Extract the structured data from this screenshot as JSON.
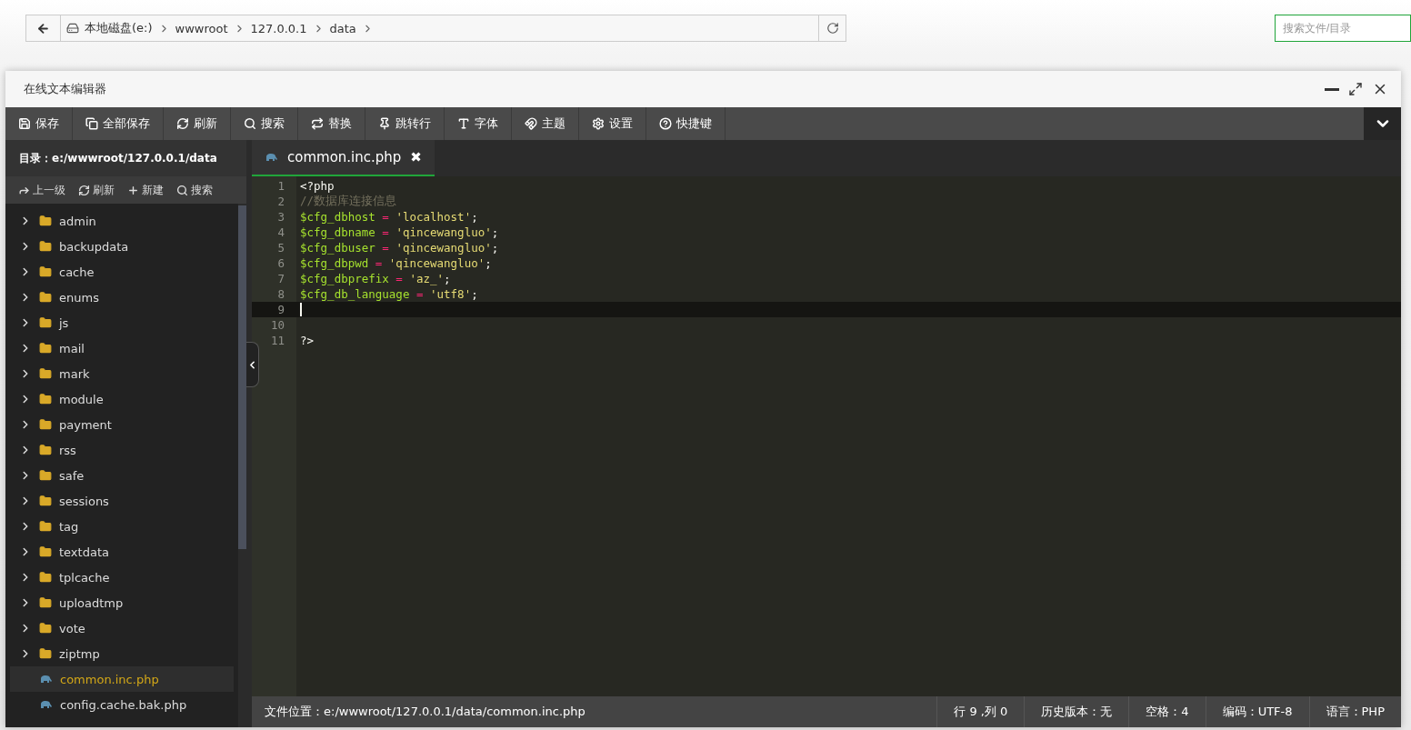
{
  "address_bar": {
    "crumbs": [
      "本地磁盘(e:)",
      "wwwroot",
      "127.0.0.1",
      "data"
    ]
  },
  "search": {
    "placeholder": "搜索文件/目录"
  },
  "window": {
    "title": "在线文本编辑器"
  },
  "toolbar": [
    "保存",
    "全部保存",
    "刷新",
    "搜索",
    "替换",
    "跳转行",
    "字体",
    "主题",
    "设置",
    "快捷键"
  ],
  "sidebar": {
    "directory": "目录：e:/wwwroot/127.0.0.1/data",
    "actions": [
      "上一级",
      "刷新",
      "新建",
      "搜索"
    ],
    "items": [
      {
        "kind": "folder",
        "name": "admin",
        "selected": false
      },
      {
        "kind": "folder",
        "name": "backupdata",
        "selected": false
      },
      {
        "kind": "folder",
        "name": "cache",
        "selected": false
      },
      {
        "kind": "folder",
        "name": "enums",
        "selected": false
      },
      {
        "kind": "folder",
        "name": "js",
        "selected": false
      },
      {
        "kind": "folder",
        "name": "mail",
        "selected": false
      },
      {
        "kind": "folder",
        "name": "mark",
        "selected": false
      },
      {
        "kind": "folder",
        "name": "module",
        "selected": false
      },
      {
        "kind": "folder",
        "name": "payment",
        "selected": false
      },
      {
        "kind": "folder",
        "name": "rss",
        "selected": false
      },
      {
        "kind": "folder",
        "name": "safe",
        "selected": false
      },
      {
        "kind": "folder",
        "name": "sessions",
        "selected": false
      },
      {
        "kind": "folder",
        "name": "tag",
        "selected": false
      },
      {
        "kind": "folder",
        "name": "textdata",
        "selected": false
      },
      {
        "kind": "folder",
        "name": "tplcache",
        "selected": false
      },
      {
        "kind": "folder",
        "name": "uploadtmp",
        "selected": false
      },
      {
        "kind": "folder",
        "name": "vote",
        "selected": false
      },
      {
        "kind": "folder",
        "name": "ziptmp",
        "selected": false
      },
      {
        "kind": "file",
        "name": "common.inc.php",
        "selected": true
      },
      {
        "kind": "file",
        "name": "config.cache.bak.php",
        "selected": false
      }
    ]
  },
  "tabs": [
    {
      "label": "common.inc.php",
      "close": "✖",
      "selected": true
    }
  ],
  "code": [
    {
      "number": "1",
      "active": false,
      "tokens": [
        {
          "kind": "plain",
          "text": "<?php"
        }
      ]
    },
    {
      "number": "2",
      "active": false,
      "tokens": [
        {
          "kind": "comment",
          "text": "//数据库连接信息"
        }
      ]
    },
    {
      "number": "3",
      "active": false,
      "tokens": [
        {
          "kind": "variable",
          "text": "$cfg_dbhost"
        },
        {
          "kind": "operator",
          "text": " = "
        },
        {
          "kind": "string",
          "text": "'localhost'"
        },
        {
          "kind": "plain",
          "text": ";"
        }
      ]
    },
    {
      "number": "4",
      "active": false,
      "tokens": [
        {
          "kind": "variable",
          "text": "$cfg_dbname"
        },
        {
          "kind": "operator",
          "text": " = "
        },
        {
          "kind": "string",
          "text": "'qincewangluo'"
        },
        {
          "kind": "plain",
          "text": ";"
        }
      ]
    },
    {
      "number": "5",
      "active": false,
      "tokens": [
        {
          "kind": "variable",
          "text": "$cfg_dbuser"
        },
        {
          "kind": "operator",
          "text": " = "
        },
        {
          "kind": "string",
          "text": "'qincewangluo'"
        },
        {
          "kind": "plain",
          "text": ";"
        }
      ]
    },
    {
      "number": "6",
      "active": false,
      "tokens": [
        {
          "kind": "variable",
          "text": "$cfg_dbpwd"
        },
        {
          "kind": "operator",
          "text": " = "
        },
        {
          "kind": "string",
          "text": "'qincewangluo'"
        },
        {
          "kind": "plain",
          "text": ";"
        }
      ]
    },
    {
      "number": "7",
      "active": false,
      "tokens": [
        {
          "kind": "variable",
          "text": "$cfg_dbprefix"
        },
        {
          "kind": "operator",
          "text": " = "
        },
        {
          "kind": "string",
          "text": "'az_'"
        },
        {
          "kind": "plain",
          "text": ";"
        }
      ]
    },
    {
      "number": "8",
      "active": false,
      "tokens": [
        {
          "kind": "variable",
          "text": "$cfg_db_language"
        },
        {
          "kind": "operator",
          "text": " = "
        },
        {
          "kind": "string",
          "text": "'utf8'"
        },
        {
          "kind": "plain",
          "text": ";"
        }
      ]
    },
    {
      "number": "9",
      "active": true
    },
    {
      "number": "10",
      "active": false
    },
    {
      "number": "11",
      "active": false,
      "tokens": [
        {
          "kind": "plain",
          "text": "?>"
        }
      ]
    }
  ],
  "status_bar": {
    "path": "文件位置：e:/wwwroot/127.0.0.1/data/common.inc.php",
    "items": [
      "行 9 ,列 0",
      "历史版本：无",
      "空格：4",
      "编码：UTF-8",
      "语言：PHP"
    ]
  }
}
